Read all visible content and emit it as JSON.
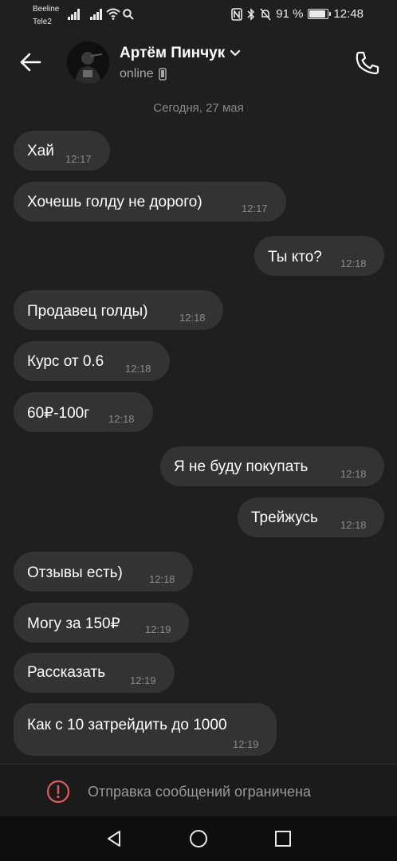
{
  "status_bar": {
    "carrier1": "Beeline",
    "carrier2": "Tele2",
    "battery": "91 %",
    "battery_level": 0.91,
    "time": "12:48"
  },
  "header": {
    "name": "Артём Пинчук",
    "status": "online"
  },
  "date_separator": "Сегодня, 27 мая",
  "messages": [
    {
      "text": "Хай",
      "time": "12:17",
      "side": "in"
    },
    {
      "text": "Хочешь голду не дорого)",
      "time": "12:17",
      "side": "in"
    },
    {
      "text": "Ты кто?",
      "time": "12:18",
      "side": "out"
    },
    {
      "text": "Продавец голды)",
      "time": "12:18",
      "side": "in"
    },
    {
      "text": "Курс от 0.6",
      "time": "12:18",
      "side": "in"
    },
    {
      "text": "60₽-100г",
      "time": "12:18",
      "side": "in"
    },
    {
      "text": "Я не буду покупать",
      "time": "12:18",
      "side": "out"
    },
    {
      "text": "Трейжусь",
      "time": "12:18",
      "side": "out"
    },
    {
      "text": "Отзывы есть)",
      "time": "12:18",
      "side": "in"
    },
    {
      "text": "Могу за 150₽",
      "time": "12:19",
      "side": "in"
    },
    {
      "text": "Рассказать",
      "time": "12:19",
      "side": "in"
    },
    {
      "text": "Как с 10 затрейдить до 1000",
      "time": "12:19",
      "side": "in"
    }
  ],
  "restricted_notice": "Отправка сообщений ограничена",
  "colors": {
    "background": "#1f1f1f",
    "bubble": "#333333",
    "warning": "#e05a5a"
  },
  "icons": [
    "back-arrow-icon",
    "chevron-down-icon",
    "phone-icon",
    "mobile-device-icon",
    "warning-icon",
    "nav-back-icon",
    "nav-home-icon",
    "nav-recents-icon"
  ]
}
